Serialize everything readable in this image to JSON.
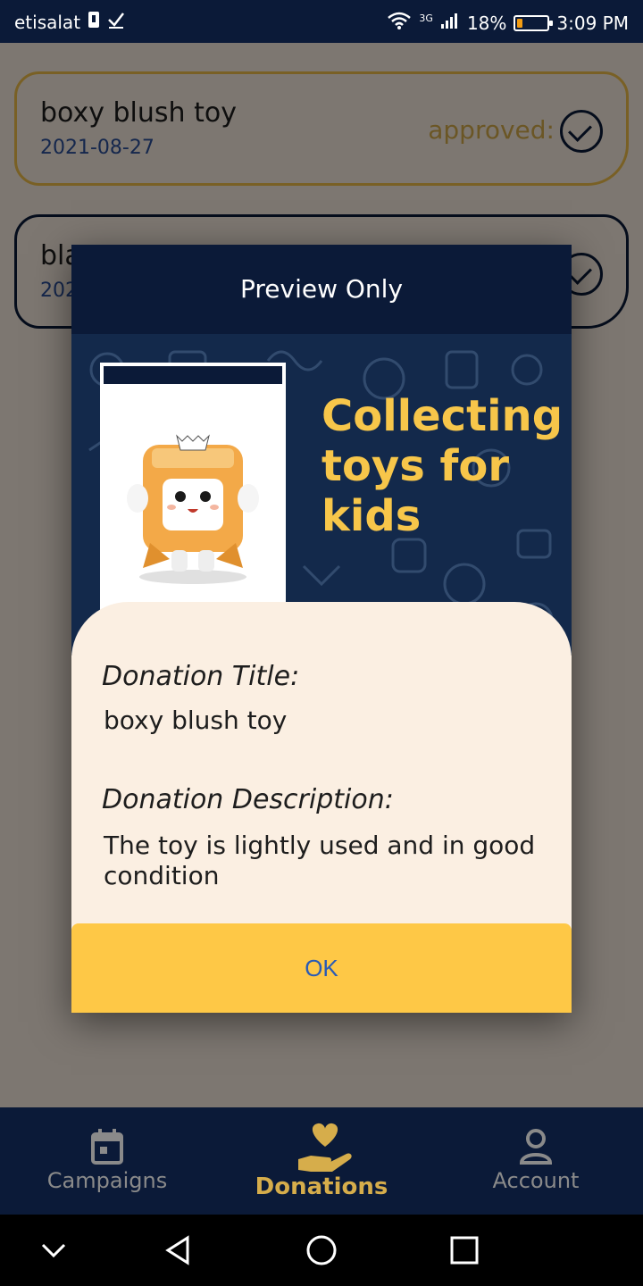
{
  "status_bar": {
    "carrier": "etisalat",
    "network": "3G",
    "battery": "18%",
    "battery_level": 0.18,
    "time": "3:09 PM"
  },
  "donations": [
    {
      "title": "boxy blush toy",
      "date": "2021-08-27",
      "status": "approved:"
    },
    {
      "title": "bla",
      "date": "202"
    }
  ],
  "dialog": {
    "header": "Preview Only",
    "banner_text": "Collecting toys for kids",
    "title_label": "Donation Title:",
    "title_value": "boxy blush toy",
    "description_label": "Donation Description:",
    "description_value": "The toy is lightly used and in good condition",
    "ok_label": "OK"
  },
  "bottom_nav": [
    {
      "label": "Campaigns",
      "icon": "calendar-icon",
      "active": false
    },
    {
      "label": "Donations",
      "icon": "donation-heart-hand-icon",
      "active": true
    },
    {
      "label": "Account",
      "icon": "person-icon",
      "active": false
    }
  ],
  "colors": {
    "navy": "#0b1a38",
    "gold": "#fec846",
    "cream": "#fbefe2",
    "link_blue": "#2a5bb5"
  }
}
